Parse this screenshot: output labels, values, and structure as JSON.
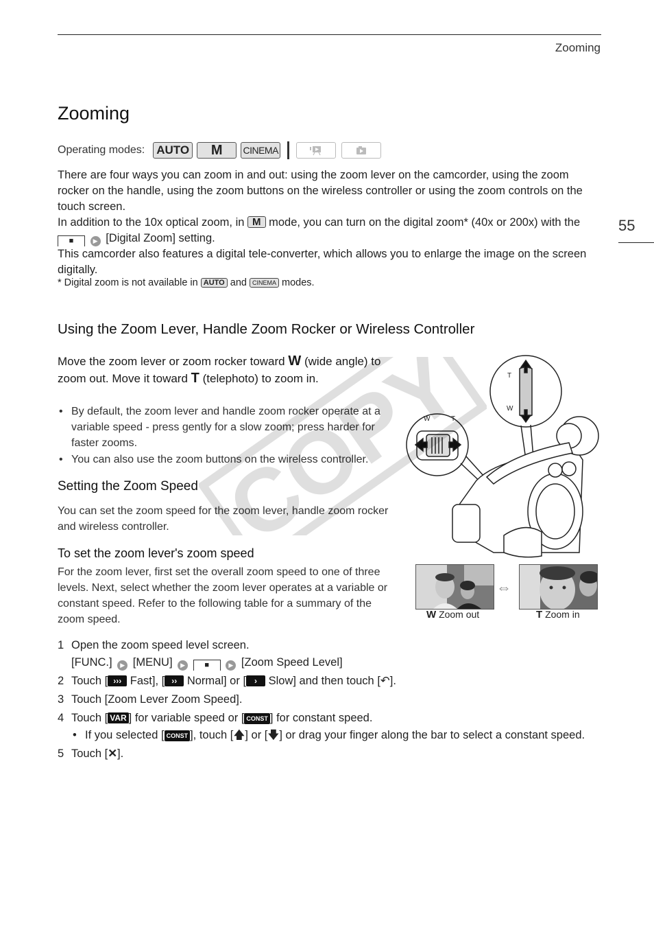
{
  "header": {
    "running_title": "Zooming",
    "page_number": "55"
  },
  "title": "Zooming",
  "operating_modes": {
    "label": "Operating modes:",
    "modes": [
      {
        "name": "AUTO",
        "active": true
      },
      {
        "name": "M",
        "active": true
      },
      {
        "name": "CINEMA",
        "active": true
      },
      {
        "name": "movie-playback-icon",
        "active": false
      },
      {
        "name": "photo-playback-icon",
        "active": false
      }
    ]
  },
  "intro": {
    "p1": "There are four ways you can zoom in and out: using the zoom lever on the camcorder, using the zoom rocker on the handle, using the zoom buttons on the wireless controller or using the zoom controls on the touch screen.",
    "p2_a": "In addition to the 10x optical zoom, in",
    "p2_mode": "M",
    "p2_b": "mode, you can turn on the digital zoom* (40x or 200x)",
    "p2_c": "with the",
    "p2_d": "[Digital Zoom] setting.",
    "p3": "This camcorder also features a digital tele-converter, which allows you to enlarge the image on the screen digitally.",
    "footnote_a": "*  Digital zoom is not available in",
    "footnote_mode1": "AUTO",
    "footnote_and": "and",
    "footnote_mode2": "CINEMA",
    "footnote_b": "modes."
  },
  "section": {
    "heading": "Using the Zoom Lever, Handle Zoom Rocker or Wireless Controller",
    "lead_a": "Move the zoom lever or zoom rocker toward",
    "lead_w": "W",
    "lead_b": "(wide angle) to zoom out. Move it toward",
    "lead_t": "T",
    "lead_c": "(telephoto) to zoom in.",
    "bullets": [
      "By default, the zoom lever and handle zoom rocker operate at a variable speed - press gently for a slow zoom; press harder for faster zooms.",
      "You can also use the zoom buttons on the wireless controller."
    ],
    "illustration": {
      "lever_labels": [
        "W",
        "T"
      ],
      "rocker_labels": [
        "T",
        "W"
      ]
    },
    "photos": {
      "out_key": "W",
      "out_label": "Zoom out",
      "in_key": "T",
      "in_label": "Zoom in"
    }
  },
  "zoom_speed": {
    "heading": "Setting the Zoom Speed",
    "text": "You can set the zoom speed for the zoom lever, handle zoom rocker and wireless controller.",
    "proc_heading": "To set the zoom lever's zoom speed",
    "proc_text": "For the zoom lever, first set the overall zoom speed to one of three levels. Next, select whether the zoom lever operates at a variable or constant speed. Refer to the following table for a summary of the zoom speed."
  },
  "steps": [
    {
      "n": "1",
      "text": "Open the zoom speed level screen.",
      "path": [
        "[FUNC.]",
        "[MENU]",
        "[Zoom Speed Level]"
      ]
    },
    {
      "n": "2",
      "a": "Touch [",
      "fast": "Fast],",
      "b": "[",
      "normal": "Normal] or [",
      "slow": "Slow] and then touch [",
      "end": "]."
    },
    {
      "n": "3",
      "text": "Touch [Zoom Lever Zoom Speed]."
    },
    {
      "n": "4",
      "a": "Touch [",
      "var": "VAR",
      "b": "] for variable speed or [",
      "const": "CONST",
      "c": "] for constant speed.",
      "sub_a": "If you selected [",
      "sub_const": "CONST",
      "sub_b": "], touch [",
      "sub_c": "] or [",
      "sub_d": "] or drag your finger along the bar to select a constant speed."
    },
    {
      "n": "5",
      "a": "Touch [",
      "b": "]."
    }
  ],
  "watermark": "COPY"
}
